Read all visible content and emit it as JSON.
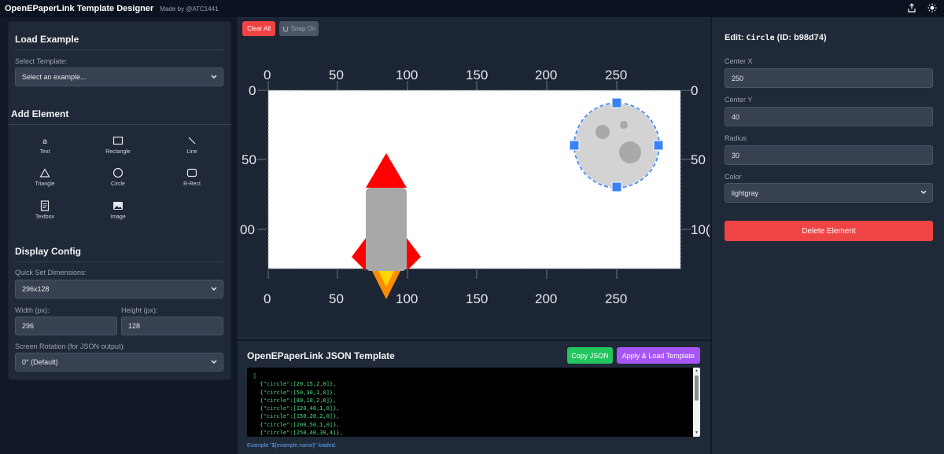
{
  "header": {
    "title": "OpenEPaperLink Template Designer",
    "subtitle": "Made by @ATC1441",
    "icons": [
      "share-icon",
      "sun-icon"
    ]
  },
  "load_example": {
    "title": "Load Example",
    "select_label": "Select Template:",
    "select_value": "Select an example..."
  },
  "add_element": {
    "title": "Add Element",
    "tools": [
      {
        "label": "Text",
        "icon": "text-icon"
      },
      {
        "label": "Rectangle",
        "icon": "rectangle-icon"
      },
      {
        "label": "Line",
        "icon": "line-icon"
      },
      {
        "label": "Triangle",
        "icon": "triangle-icon"
      },
      {
        "label": "Circle",
        "icon": "circle-icon"
      },
      {
        "label": "R-Rect",
        "icon": "rounded-rect-icon"
      },
      {
        "label": "Textbox",
        "icon": "textbox-icon"
      },
      {
        "label": "Image",
        "icon": "image-icon"
      }
    ]
  },
  "display_config": {
    "title": "Display Config",
    "quick_label": "Quick Set Dimensions:",
    "quick_value": "296x128",
    "width_label": "Width (px):",
    "width_value": "296",
    "height_label": "Height (px):",
    "height_value": "128",
    "rotation_label": "Screen Rotation (for JSON output):",
    "rotation_value": "0° (Default)"
  },
  "toolbar": {
    "clear_label": "Clear All",
    "snap_label": "Snap On"
  },
  "canvas": {
    "ruler_ticks_x": [
      "0",
      "50",
      "100",
      "150",
      "200",
      "250"
    ],
    "ruler_ticks_y": [
      "0",
      "50",
      "00"
    ],
    "ruler_ticks_y_right": [
      "0",
      "50",
      "10("
    ]
  },
  "json_panel": {
    "title": "OpenEPaperLink JSON Template",
    "copy_label": "Copy JSON",
    "apply_label": "Apply & Load Template",
    "code": "[\n  {\"circle\":[20,15,2,0]},\n  {\"circle\":[50,30,1,0]},\n  {\"circle\":[80,10,2,0]},\n  {\"circle\":[120,40,1,0]},\n  {\"circle\":[150,20,2,0]},\n  {\"circle\":[200,50,1,0]},\n  {\"circle\":[250,40,30,4]},",
    "status": "Example \"${example.name}\" loaded."
  },
  "edit_panel": {
    "title_prefix": "Edit: ",
    "title_code": "Circle",
    "title_suffix": " (ID: b98d74)",
    "fields": [
      {
        "label": "Center X",
        "value": "250"
      },
      {
        "label": "Center Y",
        "value": "40"
      },
      {
        "label": "Radius",
        "value": "30"
      }
    ],
    "color_label": "Color",
    "color_value": "lightgray",
    "delete_label": "Delete Element"
  },
  "colors": {
    "accent_red": "#ef4444",
    "accent_green": "#22c55e",
    "accent_purple": "#a855f7",
    "selection_blue": "#3b82f6"
  }
}
